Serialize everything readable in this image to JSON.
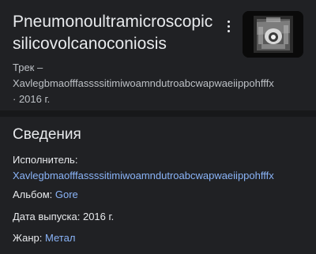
{
  "header": {
    "title": "Pneumonoultramicroscopic silicovolcanoconiosis",
    "type_label": "Трек –",
    "artist": "Xavlegbmaofffassssitimiwoamndutroabcwapwaeiippohfffx",
    "year_line": "· 2016 г.",
    "menu_icon": "more-vert-icon",
    "thumbnail_icon": "album-art"
  },
  "details": {
    "heading": "Сведения",
    "artist_label": "Исполнитель:",
    "artist_value": "Xavlegbmaofffassssitimiwoamndutroabcwapwaeiippohfffx",
    "album_label": "Альбом:",
    "album_value": "Gore",
    "release_label": "Дата выпуска:",
    "release_value": "2016 г.",
    "genre_label": "Жанр:",
    "genre_value": "Метал"
  },
  "colors": {
    "background": "#202124",
    "text": "#e8eaed",
    "secondary_text": "#bdc1c6",
    "link": "#8ab4f8",
    "divider": "#17181a"
  }
}
